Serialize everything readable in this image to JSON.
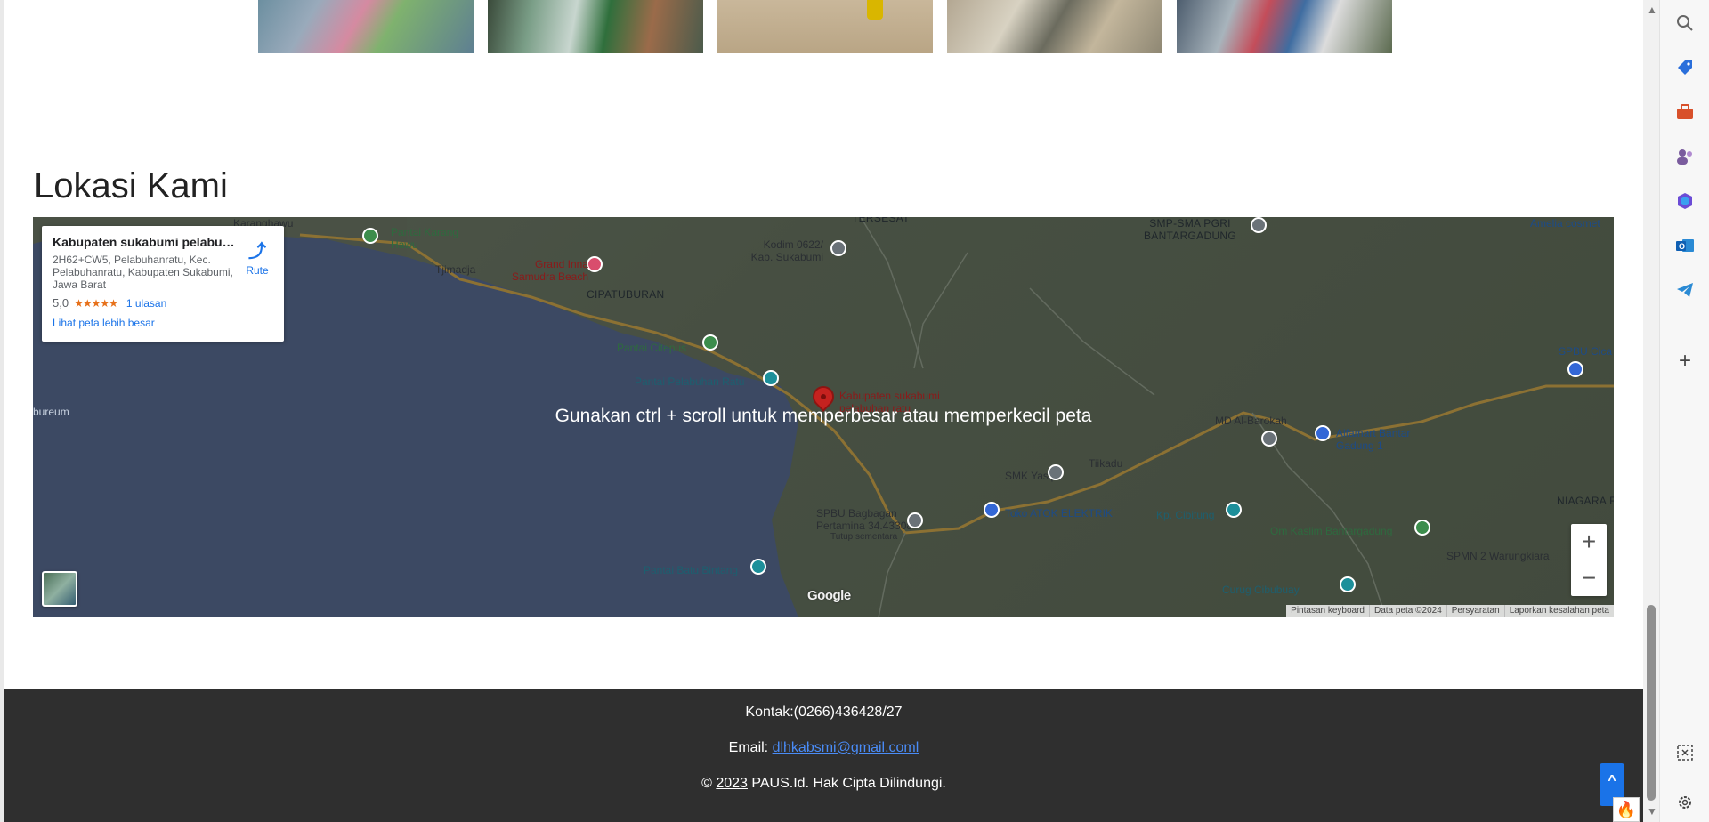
{
  "section_title": "Lokasi Kami",
  "map": {
    "hint": "Gunakan ctrl + scroll untuk memperbesar atau memperkecil peta",
    "place_card": {
      "name": "Kabupaten sukabumi pelabuh...",
      "address": "2H62+CW5, Pelabuhanratu, Kec. Pelabuhanratu, Kabupaten Sukabumi, Jawa Barat",
      "rating": "5,0",
      "stars": "★★★★★",
      "reviews": "1 ulasan",
      "bigger_map": "Lihat peta lebih besar",
      "directions": "Rute"
    },
    "labels": {
      "karanghawu": "Karanghawu",
      "pantai_karang_hawu": "Pantai Karang Hawu",
      "tjimadja": "Tjimadja",
      "grand_inna": "Grand Inna Samudra Beach",
      "cipatuburan": "CIPATUBURAN",
      "tersesat": "TERSESAT",
      "kodim": "Kodim 0622/ Kab. Sukabumi",
      "smp_sma": "SMP-SMA PGRI BANTARGADUNG",
      "amelia": "Amelia cosmet",
      "pantai_citepus": "Pantai Citepus",
      "pantai_pelabuhan_ratu": "Pantai Pelabuhan Ratu",
      "kab_sukabumi_pin": "Kabupaten sukabumi pelabuhan ratu",
      "spbu_cica": "SPBU Cica",
      "bureum": "bureum",
      "md_al_barokah": "MD Al-Barokah",
      "alfamart": "Alfamart Bantar Gadung 1",
      "smk_yasipa": "SMK Yasipa",
      "tiikadu": "Tiikadu",
      "niagara": "NIAGARA RAF",
      "spbu_bagbagan": "SPBU Bagbagan Pertamina 34.43308",
      "tutup_sementara": "Tutup sementara",
      "toko_atok": "Toko ATOK ELEKTRIK",
      "kp_cibitung": "Kp. Cibitung",
      "om_kaslim": "Om Kaslim Bantargadung",
      "spmn2": "SPMN 2 Warungkiara",
      "pantai_batu_bintang": "Pantai Batu Bintang",
      "curug_cibubuay": "Curug Cibubuay"
    },
    "google": "Google",
    "attribution": [
      "Pintasan keyboard",
      "Data peta ©2024",
      "Persyaratan",
      "Laporkan kesalahan peta"
    ],
    "zoom_in": "+",
    "zoom_out": "−"
  },
  "footer": {
    "contact": "Kontak:(0266)436428/27",
    "email_label": "Email: ",
    "email": "dlhkabsmi@gmail.coml",
    "copy_symbol": "© ",
    "year": "2023",
    "copy_rest": " PAUS.Id. Hak Cipta Dilindungi.",
    "back_to_top": "^"
  },
  "side_panel": {
    "icons": [
      "search-icon",
      "tag-icon",
      "briefcase-icon",
      "people-icon",
      "copilot-icon",
      "outlook-icon",
      "telegram-icon",
      "add-icon",
      "screenshot-icon",
      "settings-icon"
    ]
  },
  "colors": {
    "footer_bg": "#2f2f2f",
    "link": "#1a73e8",
    "map_pin": "#c5221f",
    "sea": "#56698f"
  }
}
